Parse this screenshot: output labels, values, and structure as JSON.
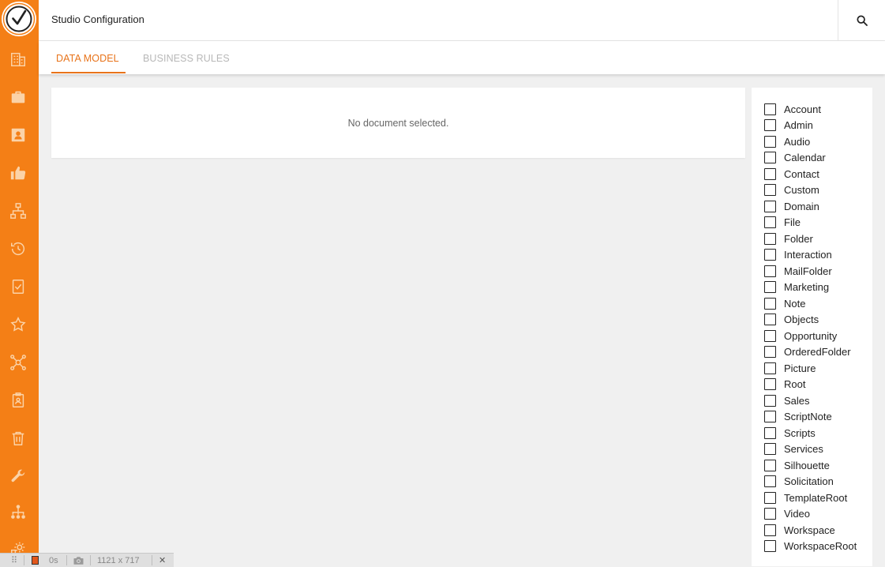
{
  "header": {
    "title": "Studio Configuration"
  },
  "tabs": [
    {
      "label": "DATA MODEL",
      "active": true
    },
    {
      "label": "BUSINESS RULES",
      "active": false
    }
  ],
  "document": {
    "empty_message": "No document selected."
  },
  "filters": [
    {
      "label": "Account",
      "checked": false
    },
    {
      "label": "Admin",
      "checked": false
    },
    {
      "label": "Audio",
      "checked": false
    },
    {
      "label": "Calendar",
      "checked": false
    },
    {
      "label": "Contact",
      "checked": false
    },
    {
      "label": "Custom",
      "checked": false
    },
    {
      "label": "Domain",
      "checked": false
    },
    {
      "label": "File",
      "checked": false
    },
    {
      "label": "Folder",
      "checked": false
    },
    {
      "label": "Interaction",
      "checked": false
    },
    {
      "label": "MailFolder",
      "checked": false
    },
    {
      "label": "Marketing",
      "checked": false
    },
    {
      "label": "Note",
      "checked": false
    },
    {
      "label": "Objects",
      "checked": false
    },
    {
      "label": "Opportunity",
      "checked": false
    },
    {
      "label": "OrderedFolder",
      "checked": false
    },
    {
      "label": "Picture",
      "checked": false
    },
    {
      "label": "Root",
      "checked": false
    },
    {
      "label": "Sales",
      "checked": false
    },
    {
      "label": "ScriptNote",
      "checked": false
    },
    {
      "label": "Scripts",
      "checked": false
    },
    {
      "label": "Services",
      "checked": false
    },
    {
      "label": "Silhouette",
      "checked": false
    },
    {
      "label": "Solicitation",
      "checked": false
    },
    {
      "label": "TemplateRoot",
      "checked": false
    },
    {
      "label": "Video",
      "checked": false
    },
    {
      "label": "Workspace",
      "checked": false
    },
    {
      "label": "WorkspaceRoot",
      "checked": false
    }
  ],
  "sidebar": {
    "icons": [
      "building-icon",
      "briefcase-icon",
      "contact-card-icon",
      "thumbs-up-icon",
      "hierarchy-icon",
      "history-icon",
      "checklist-icon",
      "star-icon",
      "network-icon",
      "clipboard-user-icon",
      "trash-icon",
      "wrench-icon",
      "org-chart-icon",
      "settings-partial-icon"
    ]
  },
  "statusbar": {
    "timer": "0s",
    "dimensions": "1121 x 717",
    "close": "✕"
  },
  "colors": {
    "sidebar": "#f47f16",
    "accent": "#e8731a",
    "inactive_tab": "#b8b8b8",
    "background": "#f0f0f0"
  }
}
